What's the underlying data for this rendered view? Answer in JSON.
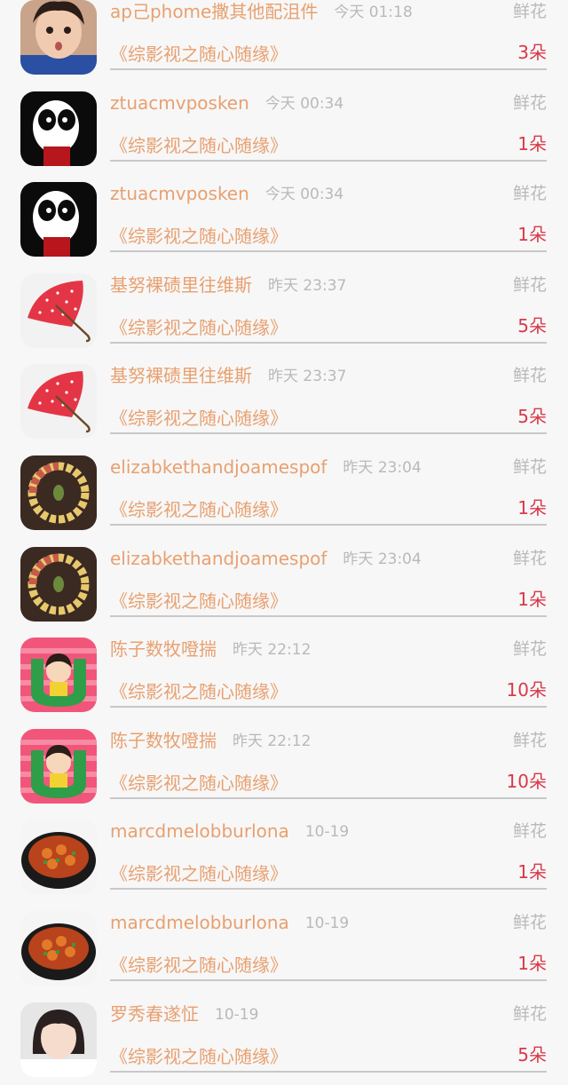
{
  "rows": [
    {
      "name": "ap己phome撒其他配沮件",
      "time": "今天 01:18",
      "gift": "鲜花",
      "book": "《综影视之随心随缘》",
      "count": "3朵",
      "avatar_icon": "boy-face-avatar"
    },
    {
      "name": "ztuacmvposken",
      "time": "今天 00:34",
      "gift": "鲜花",
      "book": "《综影视之随心随缘》",
      "count": "1朵",
      "avatar_icon": "panda-cartoon-avatar"
    },
    {
      "name": "ztuacmvposken",
      "time": "今天 00:34",
      "gift": "鲜花",
      "book": "《综影视之随心随缘》",
      "count": "1朵",
      "avatar_icon": "panda-cartoon-avatar"
    },
    {
      "name": "基努裸碛里往维斯",
      "time": "昨天 23:37",
      "gift": "鲜花",
      "book": "《综影视之随心随缘》",
      "count": "5朵",
      "avatar_icon": "red-umbrella-avatar"
    },
    {
      "name": "基努裸碛里往维斯",
      "time": "昨天 23:37",
      "gift": "鲜花",
      "book": "《综影视之随心随缘》",
      "count": "5朵",
      "avatar_icon": "red-umbrella-avatar"
    },
    {
      "name": "elizabkethandjoamespof",
      "time": "昨天 23:04",
      "gift": "鲜花",
      "book": "《综影视之随心随缘》",
      "count": "1朵",
      "avatar_icon": "soil-ring-avatar"
    },
    {
      "name": "elizabkethandjoamespof",
      "time": "昨天 23:04",
      "gift": "鲜花",
      "book": "《综影视之随心随缘》",
      "count": "1朵",
      "avatar_icon": "soil-ring-avatar"
    },
    {
      "name": "陈子数牧噔揣",
      "time": "昨天 22:12",
      "gift": "鲜花",
      "book": "《综影视之随心随缘》",
      "count": "10朵",
      "avatar_icon": "girl-cartoon-avatar"
    },
    {
      "name": "陈子数牧噔揣",
      "time": "昨天 22:12",
      "gift": "鲜花",
      "book": "《综影视之随心随缘》",
      "count": "10朵",
      "avatar_icon": "girl-cartoon-avatar"
    },
    {
      "name": "marcdmelobburlona",
      "time": "10-19",
      "gift": "鲜花",
      "book": "《综影视之随心随缘》",
      "count": "1朵",
      "avatar_icon": "food-dish-avatar"
    },
    {
      "name": "marcdmelobburlona",
      "time": "10-19",
      "gift": "鲜花",
      "book": "《综影视之随心随缘》",
      "count": "1朵",
      "avatar_icon": "food-dish-avatar"
    },
    {
      "name": "罗秀春遂怔",
      "time": "10-19",
      "gift": "鲜花",
      "book": "《综影视之随心随缘》",
      "count": "5朵",
      "avatar_icon": "girl-photo-avatar"
    }
  ]
}
